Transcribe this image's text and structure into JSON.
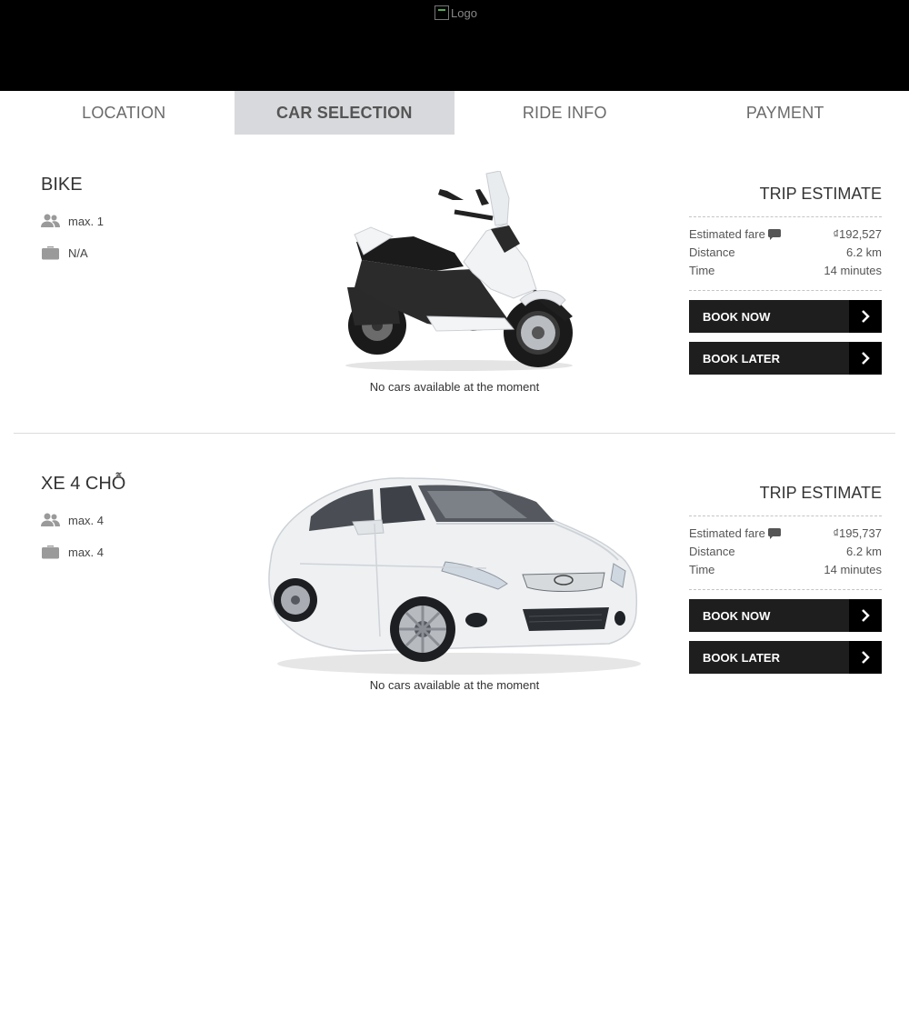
{
  "header": {
    "logo_alt": "Logo"
  },
  "tabs": [
    {
      "label": "LOCATION",
      "active": false
    },
    {
      "label": "CAR SELECTION",
      "active": true
    },
    {
      "label": "RIDE INFO",
      "active": false
    },
    {
      "label": "PAYMENT",
      "active": false
    }
  ],
  "vehicles": [
    {
      "name": "BIKE",
      "passengers": "max. 1",
      "luggage": "N/A",
      "availability": "No cars available at the moment",
      "estimate": {
        "title": "TRIP ESTIMATE",
        "fare_label": "Estimated fare",
        "fare_value": "₫192,527",
        "distance_label": "Distance",
        "distance_value": "6.2 km",
        "time_label": "Time",
        "time_value": "14 minutes"
      },
      "book_now": "BOOK NOW",
      "book_later": "BOOK LATER"
    },
    {
      "name": "XE 4 CHỖ",
      "passengers": "max. 4",
      "luggage": "max. 4",
      "availability": "No cars available at the moment",
      "estimate": {
        "title": "TRIP ESTIMATE",
        "fare_label": "Estimated fare",
        "fare_value": "₫195,737",
        "distance_label": "Distance",
        "distance_value": "6.2 km",
        "time_label": "Time",
        "time_value": "14 minutes"
      },
      "book_now": "BOOK NOW",
      "book_later": "BOOK LATER"
    }
  ],
  "colors": {
    "header_bg": "#000000",
    "active_tab_bg": "#d8d9dc",
    "button_bg": "#1e1e1e",
    "icon_gray": "#9a9a9a"
  },
  "icons": {
    "passengers": "users-icon",
    "luggage": "briefcase-icon",
    "fare_info": "comment-icon",
    "button_arrow": "chevron-right-icon"
  }
}
